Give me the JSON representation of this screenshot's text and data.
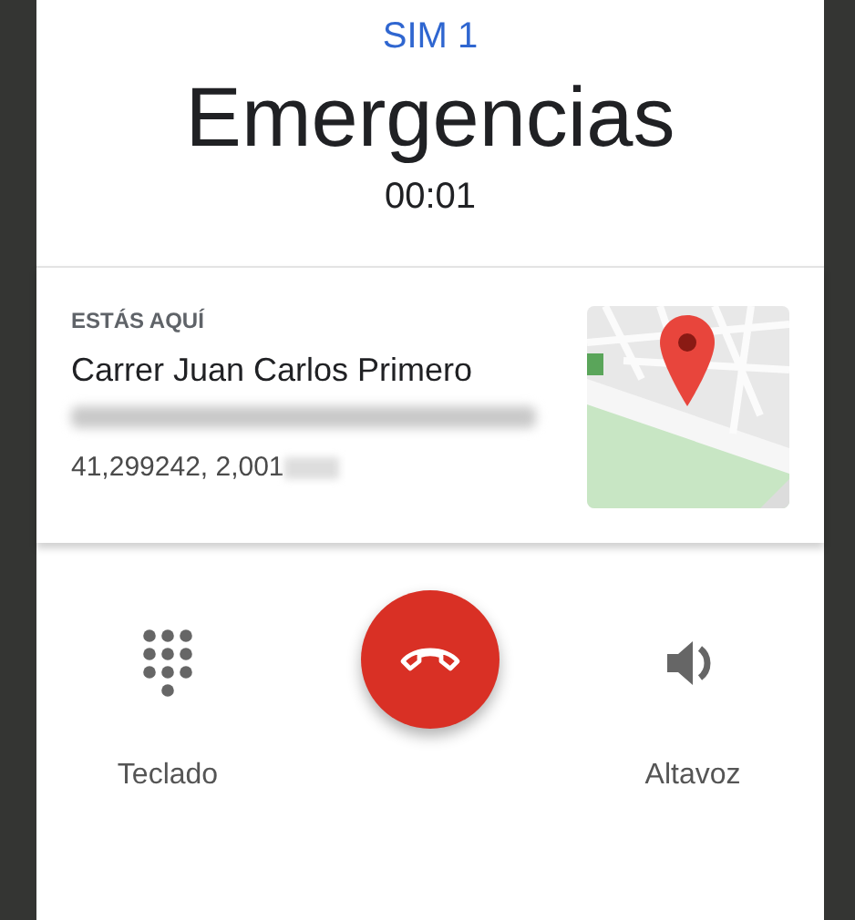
{
  "call": {
    "sim": "SIM 1",
    "name": "Emergencias",
    "duration": "00:01"
  },
  "location": {
    "heading": "ESTÁS AQUÍ",
    "street": "Carrer Juan Carlos Primero",
    "coordinates": "41,299242, 2,001"
  },
  "actions": [
    {
      "kind": "keypad",
      "label": "Teclado"
    },
    {
      "kind": "hangup"
    },
    {
      "kind": "speaker",
      "label": "Altavoz"
    }
  ]
}
